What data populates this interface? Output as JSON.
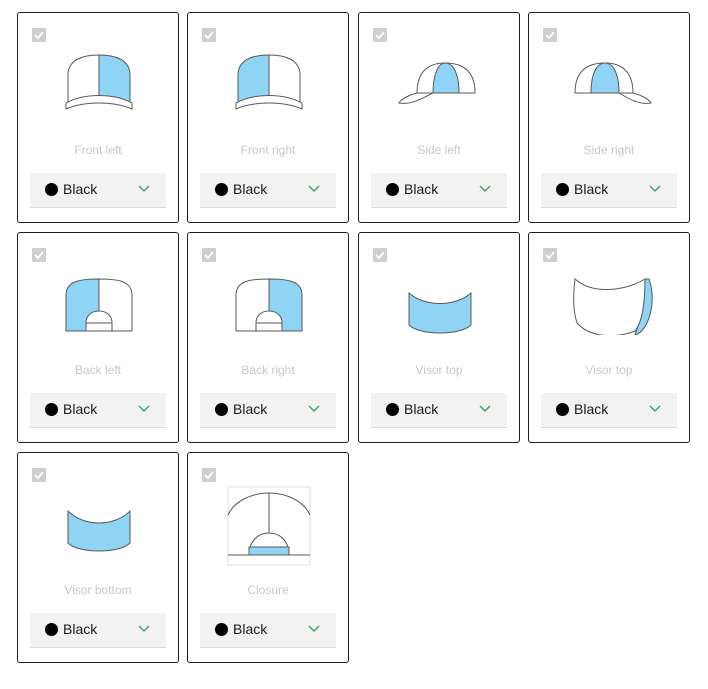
{
  "colors": {
    "panel_fill": "#8fd3f5",
    "outline": "#5a5a5a",
    "chevron": "#3aa76d"
  },
  "cards": [
    {
      "label": "Front left",
      "color_value": "Black"
    },
    {
      "label": "Front right",
      "color_value": "Black"
    },
    {
      "label": "Side left",
      "color_value": "Black"
    },
    {
      "label": "Side right",
      "color_value": "Black"
    },
    {
      "label": "Back left",
      "color_value": "Black"
    },
    {
      "label": "Back right",
      "color_value": "Black"
    },
    {
      "label": "Visor top",
      "color_value": "Black"
    },
    {
      "label": "Visor top",
      "color_value": "Black"
    },
    {
      "label": "Visor bottom",
      "color_value": "Black"
    },
    {
      "label": "Closure",
      "color_value": "Black"
    }
  ]
}
